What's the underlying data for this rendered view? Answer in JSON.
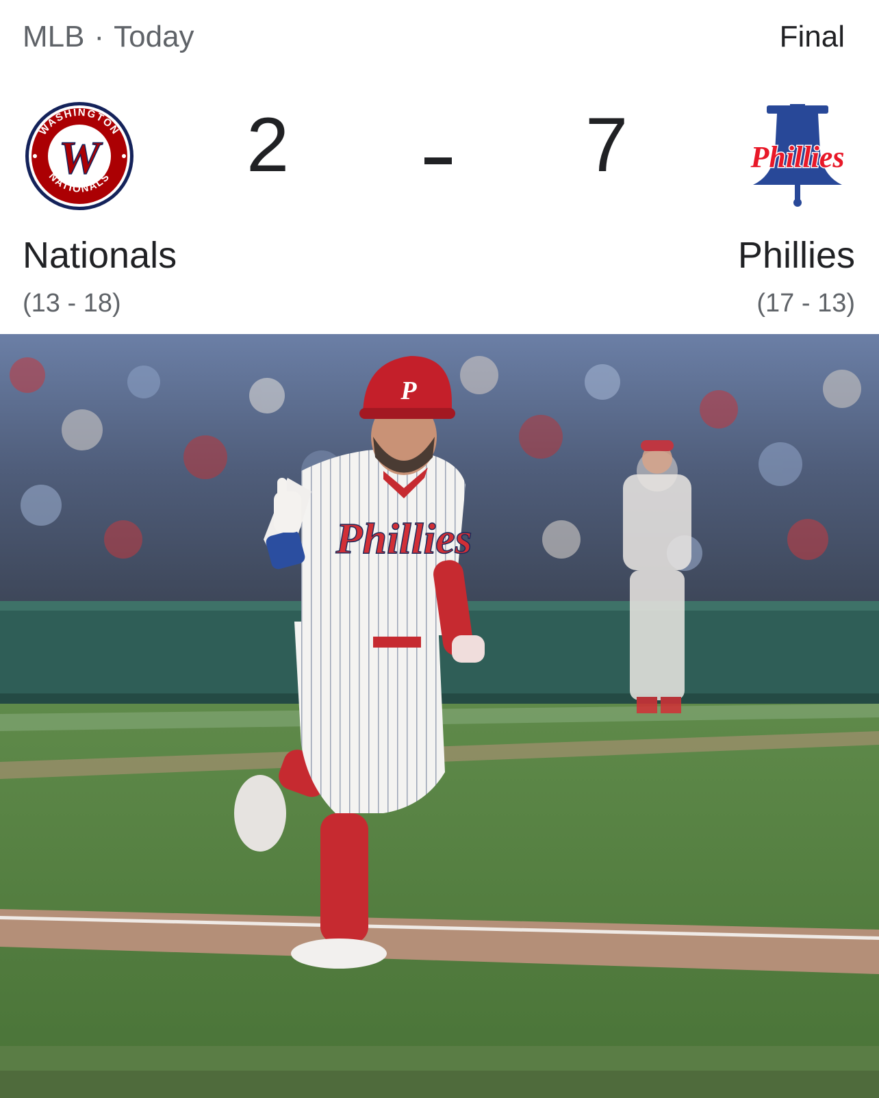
{
  "header": {
    "league": "MLB",
    "separator": "·",
    "date": "Today",
    "status": "Final"
  },
  "away_team": {
    "name": "Nationals",
    "record": "(13 - 18)",
    "score": "2",
    "logo_icon": "washington-nationals-logo",
    "logo_text_top": "WASHINGTON",
    "logo_text_bottom": "NATIONALS",
    "colors": {
      "navy": "#14225a",
      "red": "#ab0003"
    }
  },
  "home_team": {
    "name": "Phillies",
    "record": "(17 - 13)",
    "score": "7",
    "logo_icon": "philadelphia-phillies-logo",
    "logo_text": "Phillies",
    "colors": {
      "red": "#e81828",
      "blue": "#284898"
    }
  },
  "score_separator": "-",
  "media": {
    "jersey_text": "Phillies",
    "helmet_letter": "P"
  }
}
